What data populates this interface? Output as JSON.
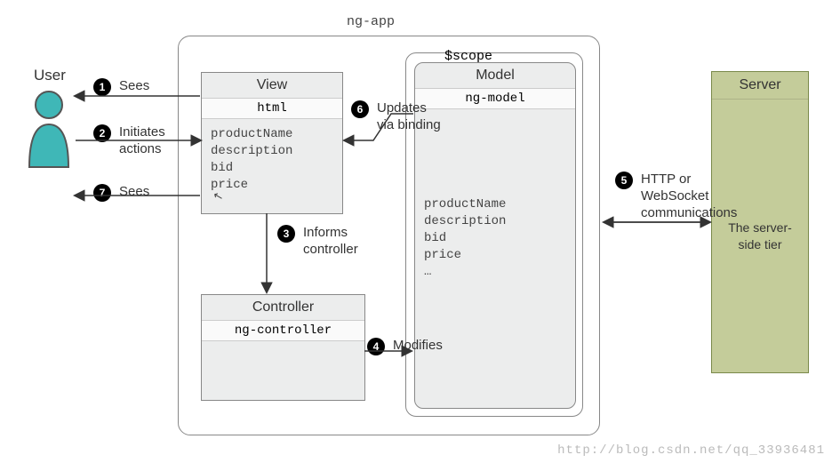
{
  "user": {
    "label": "User"
  },
  "container": {
    "ngapp": "ng-app",
    "scope": "$scope"
  },
  "view": {
    "title": "View",
    "sub": "html",
    "fields": "productName\ndescription\nbid\nprice"
  },
  "controller": {
    "title": "Controller",
    "sub": "ng-controller"
  },
  "model": {
    "title": "Model",
    "sub": "ng-model",
    "fields": "productName\ndescription\nbid\nprice\n…"
  },
  "server": {
    "title": "Server",
    "body": "The server-side tier"
  },
  "steps": {
    "s1": "Sees",
    "s2": "Initiates\nactions",
    "s3": "Informs\ncontroller",
    "s4": "Modifies",
    "s5": "HTTP or\nWebSocket\ncommunications",
    "s6": "Updates\nvia binding",
    "s7": "Sees"
  },
  "watermark": "http://blog.csdn.net/qq_33936481"
}
